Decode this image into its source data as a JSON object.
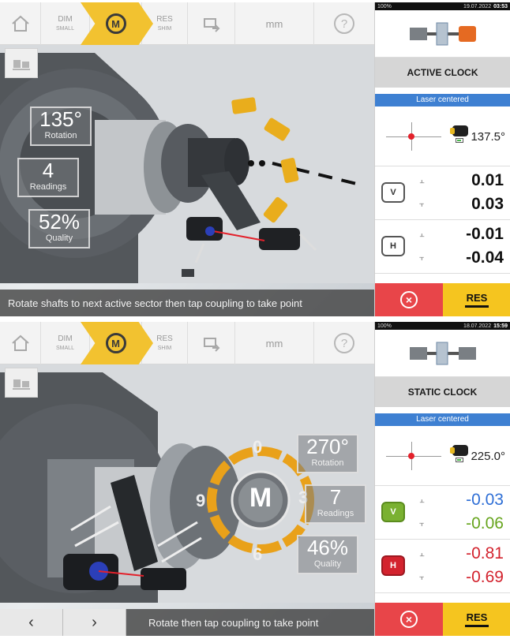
{
  "screens": [
    {
      "toolbar": {
        "dim_label": "DIM",
        "dim_sub": "SMALL",
        "meas_label": "M",
        "res_label": "RES",
        "res_sub": "SHIM",
        "unit_label": "mm",
        "help_label": "?"
      },
      "metrics": {
        "rotation_value": "135°",
        "rotation_label": "Rotation",
        "readings_value": "4",
        "readings_label": "Readings",
        "quality_value": "52%",
        "quality_label": "Quality"
      },
      "status_text": "Rotate shafts to next active sector then tap coupling to take point",
      "panel": {
        "sys_battery": "100%",
        "sys_time": "03:53",
        "sys_date": "19.07.2022",
        "mode_title": "ACTIVE CLOCK",
        "laser_status": "Laser centered",
        "angle": "137.5°",
        "v_label": "V",
        "v_values": [
          "0.01",
          "0.03"
        ],
        "h_label": "H",
        "h_values": [
          "-0.01",
          "-0.04"
        ],
        "res_button": "RES"
      },
      "colors": {
        "v_values": "#111111",
        "h_values": "#111111"
      }
    },
    {
      "toolbar": {
        "dim_label": "DIM",
        "dim_sub": "SMALL",
        "meas_label": "M",
        "res_label": "RES",
        "res_sub": "SHIM",
        "unit_label": "mm",
        "help_label": "?"
      },
      "metrics": {
        "rotation_value": "270°",
        "rotation_label": "Rotation",
        "readings_value": "7",
        "readings_label": "Readings",
        "quality_value": "46%",
        "quality_label": "Quality"
      },
      "clock_marks": [
        "0",
        "3",
        "6",
        "9"
      ],
      "status_text": "Rotate then tap coupling to take point",
      "nav": {
        "prev": "‹",
        "next": "›"
      },
      "panel": {
        "sys_battery": "100%",
        "sys_time": "15:59",
        "sys_date": "18.07.2022",
        "mode_title": "STATIC CLOCK",
        "laser_status": "Laser centered",
        "angle": "225.0°",
        "v_label": "V",
        "v_values": [
          "-0.03",
          "-0.06"
        ],
        "h_label": "H",
        "h_values": [
          "-0.81",
          "-0.69"
        ],
        "res_button": "RES"
      },
      "colors": {
        "v_value_1": "#2f6fd6",
        "v_value_2": "#67a51e",
        "h_values": "#d3232e"
      }
    }
  ]
}
